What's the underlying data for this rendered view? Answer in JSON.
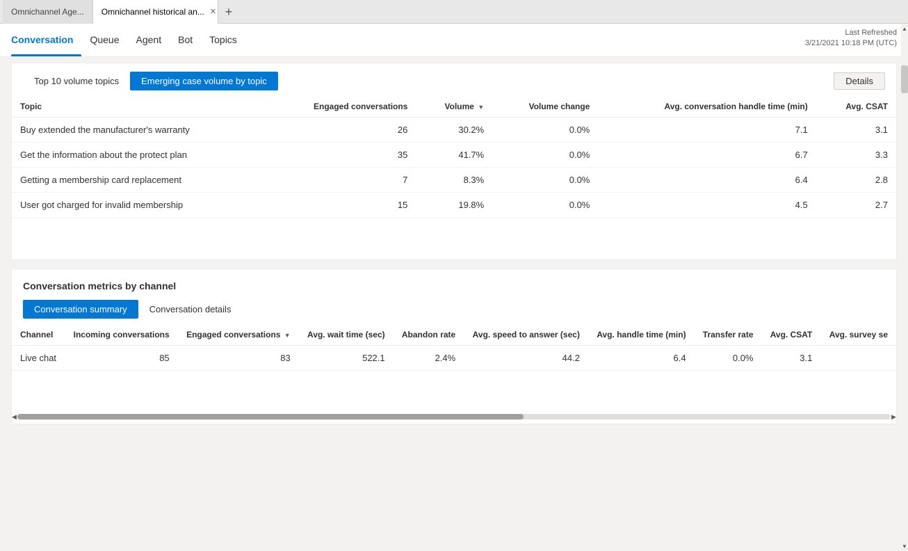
{
  "browser": {
    "tabs": [
      {
        "id": "tab1",
        "label": "Omnichannel Age...",
        "active": false,
        "closable": false
      },
      {
        "id": "tab2",
        "label": "Omnichannel historical an...",
        "active": true,
        "closable": true
      }
    ],
    "add_tab_label": "+"
  },
  "top_nav": {
    "items": [
      {
        "id": "conversation",
        "label": "Conversation",
        "active": true
      },
      {
        "id": "queue",
        "label": "Queue",
        "active": false
      },
      {
        "id": "agent",
        "label": "Agent",
        "active": false
      },
      {
        "id": "bot",
        "label": "Bot",
        "active": false
      },
      {
        "id": "topics",
        "label": "Topics",
        "active": false
      }
    ],
    "last_refreshed_label": "Last Refreshed",
    "last_refreshed_value": "3/21/2021 10:18 PM (UTC)"
  },
  "topics_card": {
    "tabs": [
      {
        "id": "top10",
        "label": "Top 10 volume topics",
        "active": false
      },
      {
        "id": "emerging",
        "label": "Emerging case volume by topic",
        "active": true
      }
    ],
    "details_button": "Details",
    "table": {
      "columns": [
        {
          "id": "topic",
          "label": "Topic",
          "align": "left"
        },
        {
          "id": "engaged_conversations",
          "label": "Engaged conversations",
          "align": "right"
        },
        {
          "id": "volume",
          "label": "Volume",
          "align": "right",
          "sortable": true
        },
        {
          "id": "volume_change",
          "label": "Volume change",
          "align": "right"
        },
        {
          "id": "avg_handle_time",
          "label": "Avg. conversation handle time (min)",
          "align": "right"
        },
        {
          "id": "avg_csat",
          "label": "Avg. CSAT",
          "align": "right"
        }
      ],
      "rows": [
        {
          "topic": "Buy extended the manufacturer's warranty",
          "engaged_conversations": "26",
          "volume": "30.2%",
          "volume_change": "0.0%",
          "avg_handle_time": "7.1",
          "avg_csat": "3.1"
        },
        {
          "topic": "Get the information about the protect plan",
          "engaged_conversations": "35",
          "volume": "41.7%",
          "volume_change": "0.0%",
          "avg_handle_time": "6.7",
          "avg_csat": "3.3"
        },
        {
          "topic": "Getting a membership card replacement",
          "engaged_conversations": "7",
          "volume": "8.3%",
          "volume_change": "0.0%",
          "avg_handle_time": "6.4",
          "avg_csat": "2.8"
        },
        {
          "topic": "User got charged for invalid membership",
          "engaged_conversations": "15",
          "volume": "19.8%",
          "volume_change": "0.0%",
          "avg_handle_time": "4.5",
          "avg_csat": "2.7"
        }
      ]
    }
  },
  "metrics_card": {
    "section_title": "Conversation metrics by channel",
    "tabs": [
      {
        "id": "summary",
        "label": "Conversation summary",
        "active": true
      },
      {
        "id": "details",
        "label": "Conversation details",
        "active": false
      }
    ],
    "table": {
      "columns": [
        {
          "id": "channel",
          "label": "Channel",
          "align": "left"
        },
        {
          "id": "incoming",
          "label": "Incoming conversations",
          "align": "right"
        },
        {
          "id": "engaged",
          "label": "Engaged conversations",
          "align": "right",
          "sortable": true
        },
        {
          "id": "avg_wait",
          "label": "Avg. wait time (sec)",
          "align": "right"
        },
        {
          "id": "abandon_rate",
          "label": "Abandon rate",
          "align": "right"
        },
        {
          "id": "avg_speed",
          "label": "Avg. speed to answer (sec)",
          "align": "right"
        },
        {
          "id": "avg_handle",
          "label": "Avg. handle time (min)",
          "align": "right"
        },
        {
          "id": "transfer_rate",
          "label": "Transfer rate",
          "align": "right"
        },
        {
          "id": "avg_csat",
          "label": "Avg. CSAT",
          "align": "right"
        },
        {
          "id": "avg_survey",
          "label": "Avg. survey se",
          "align": "right"
        }
      ],
      "rows": [
        {
          "channel": "Live chat",
          "incoming": "85",
          "engaged": "83",
          "avg_wait": "522.1",
          "abandon_rate": "2.4%",
          "avg_speed": "44.2",
          "avg_handle": "6.4",
          "transfer_rate": "0.0%",
          "avg_csat": "3.1",
          "avg_survey": ""
        }
      ]
    }
  }
}
